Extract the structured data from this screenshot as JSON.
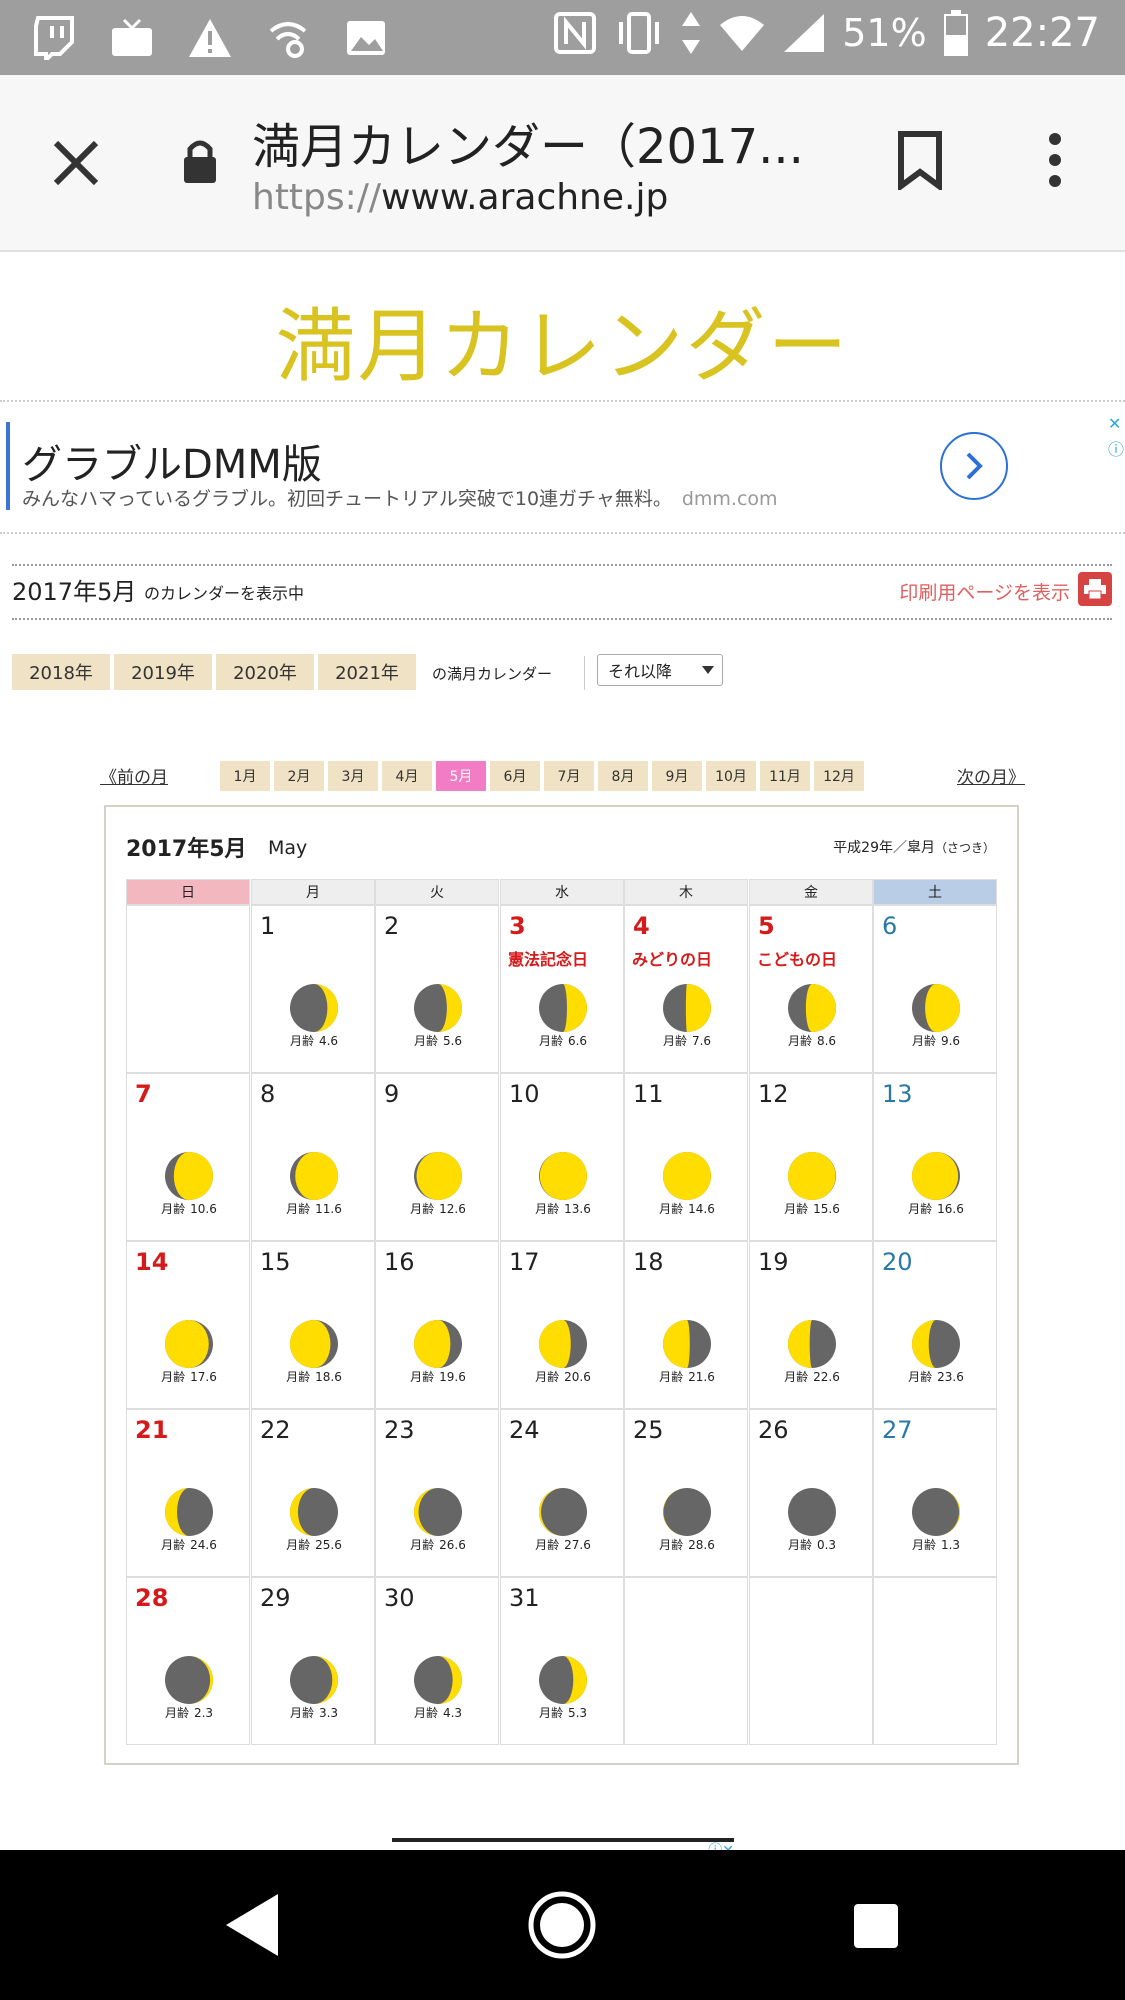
{
  "status_bar": {
    "icons": [
      "twitch-icon",
      "tv-icon",
      "warning-icon",
      "wifi-settings-icon",
      "image-icon"
    ],
    "battery_percent": "51%",
    "time": "22:27"
  },
  "browser": {
    "title": "満月カレンダー（2017...",
    "url_scheme": "https://",
    "url_host": "www.arachne.jp"
  },
  "site": {
    "title": "満月カレンダー"
  },
  "ad": {
    "title": "グラブルDMM版",
    "description": "みんなハマっているグラブル。初回チュートリアル突破で10連ガチャ無料。",
    "domain": "dmm.com"
  },
  "current": {
    "date": "2017年5月",
    "suffix": "のカレンダーを表示中",
    "print_link": "印刷用ページを表示"
  },
  "years": {
    "items": [
      "2018年",
      "2019年",
      "2020年",
      "2021年"
    ],
    "suffix": "の満月カレンダー",
    "select_value": "それ以降"
  },
  "month_nav": {
    "prev": "前の月",
    "next": "次の月",
    "months": [
      "1月",
      "2月",
      "3月",
      "4月",
      "5月",
      "6月",
      "7月",
      "8月",
      "9月",
      "10月",
      "11月",
      "12月"
    ],
    "active_index": 4
  },
  "calendar": {
    "title": "2017年5月",
    "english": "May",
    "japanese_era": "平成29年／皐月",
    "japanese_reading": "（さつき）",
    "weekdays": [
      "日",
      "月",
      "火",
      "水",
      "木",
      "金",
      "土"
    ],
    "moon_age_label": "月齢",
    "start_offset": 1,
    "days": [
      {
        "n": "1",
        "age": "4.6",
        "holiday": ""
      },
      {
        "n": "2",
        "age": "5.6",
        "holiday": ""
      },
      {
        "n": "3",
        "age": "6.6",
        "holiday": "憲法記念日"
      },
      {
        "n": "4",
        "age": "7.6",
        "holiday": "みどりの日"
      },
      {
        "n": "5",
        "age": "8.6",
        "holiday": "こどもの日"
      },
      {
        "n": "6",
        "age": "9.6",
        "holiday": ""
      },
      {
        "n": "7",
        "age": "10.6",
        "holiday": ""
      },
      {
        "n": "8",
        "age": "11.6",
        "holiday": ""
      },
      {
        "n": "9",
        "age": "12.6",
        "holiday": ""
      },
      {
        "n": "10",
        "age": "13.6",
        "holiday": ""
      },
      {
        "n": "11",
        "age": "14.6",
        "holiday": ""
      },
      {
        "n": "12",
        "age": "15.6",
        "holiday": ""
      },
      {
        "n": "13",
        "age": "16.6",
        "holiday": ""
      },
      {
        "n": "14",
        "age": "17.6",
        "holiday": ""
      },
      {
        "n": "15",
        "age": "18.6",
        "holiday": ""
      },
      {
        "n": "16",
        "age": "19.6",
        "holiday": ""
      },
      {
        "n": "17",
        "age": "20.6",
        "holiday": ""
      },
      {
        "n": "18",
        "age": "21.6",
        "holiday": ""
      },
      {
        "n": "19",
        "age": "22.6",
        "holiday": ""
      },
      {
        "n": "20",
        "age": "23.6",
        "holiday": ""
      },
      {
        "n": "21",
        "age": "24.6",
        "holiday": ""
      },
      {
        "n": "22",
        "age": "25.6",
        "holiday": ""
      },
      {
        "n": "23",
        "age": "26.6",
        "holiday": ""
      },
      {
        "n": "24",
        "age": "27.6",
        "holiday": ""
      },
      {
        "n": "25",
        "age": "28.6",
        "holiday": ""
      },
      {
        "n": "26",
        "age": "0.3",
        "holiday": ""
      },
      {
        "n": "27",
        "age": "1.3",
        "holiday": ""
      },
      {
        "n": "28",
        "age": "2.3",
        "holiday": ""
      },
      {
        "n": "29",
        "age": "3.3",
        "holiday": ""
      },
      {
        "n": "30",
        "age": "4.3",
        "holiday": ""
      },
      {
        "n": "31",
        "age": "5.3",
        "holiday": ""
      }
    ]
  },
  "colors": {
    "moon_lit": "#ffdd00",
    "moon_dark": "#666666",
    "holiday_red": "#d41a1a",
    "saturday_blue": "#2a78a6",
    "title_gold": "#d9c320",
    "active_month": "#f27dc4"
  }
}
